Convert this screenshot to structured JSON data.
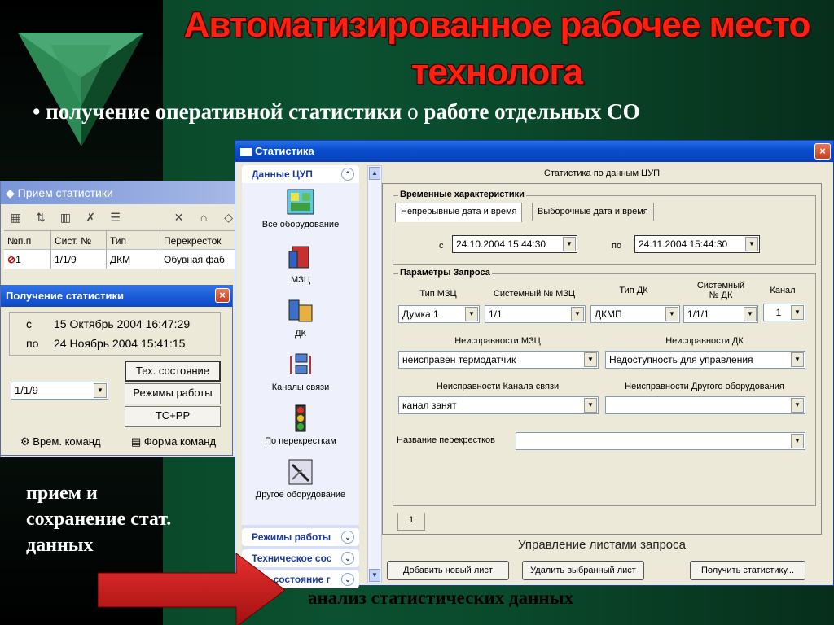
{
  "slide": {
    "title_line1": "Автоматизированное рабочее место",
    "title_line2": "технолога",
    "bullet_prefix": "• получение оперативной статистики",
    "bullet_o": "о",
    "bullet_suffix": "работе отдельных СО",
    "left_text_1": "прием и",
    "left_text_2": "сохранение стат.",
    "left_text_3": "данных",
    "bottom_text": "анализ статистических данных"
  },
  "priem_window": {
    "title": "Прием статистики",
    "columns": [
      "№п.п",
      "Сист. №",
      "Тип",
      "Перекресток"
    ],
    "row": [
      "1",
      "1/1/9",
      "ДКМ",
      "Обувная фаб"
    ]
  },
  "poluch_window": {
    "title": "Получение статистики",
    "close": "×",
    "from_label": "с",
    "from_value": "15 Октябрь 2004 16:47:29",
    "to_label": "по",
    "to_value": "24 Ноябрь 2004 15:41:15",
    "combo_value": "1/1/9",
    "btn_tech": "Тех. состояние",
    "btn_modes": "Режимы работы",
    "btn_tcpp": "ТС+РР",
    "foot_time": "Врем. команд",
    "foot_form": "Форма команд"
  },
  "stat_window": {
    "title": "Статистика",
    "close": "×",
    "sidebar": {
      "header": "Данные ЦУП",
      "items": [
        "Все оборудование",
        "МЗЦ",
        "ДК",
        "Каналы связи",
        "По перекресткам",
        "Другое оборудование"
      ],
      "groups": [
        "Режимы работы",
        "Техническое сос",
        "Тех. состояние г"
      ]
    },
    "main": {
      "caption": "Статистика по данным ЦУП",
      "time_group": "Временные характеристики",
      "tab1": "Непрерывные дата и время",
      "tab2": "Выборочные дата и время",
      "from_label": "с",
      "from_value": "24.10.2004  15:44:30",
      "to_label": "по",
      "to_value": "24.11.2004  15:44:30",
      "params_group": "Параметры Запроса",
      "col_type_mzc": "Тип МЗЦ",
      "col_sys_mzc": "Системный № МЗЦ",
      "col_type_dk": "Тип ДК",
      "col_sys_dk_1": "Системный",
      "col_sys_dk_2": "№ ДК",
      "col_channel": "Канал",
      "val_type_mzc": "Думка 1",
      "val_sys_mzc": "1/1",
      "val_type_dk": "ДКМП",
      "val_sys_dk": "1/1/1",
      "val_channel": "1",
      "lbl_mzc_faults": "Неисправности МЗЦ",
      "lbl_dk_faults": "Неисправности ДК",
      "val_mzc_faults": "неисправен термодатчик",
      "val_dk_faults": "Недоступность для управления",
      "lbl_chan_faults": "Неисправности Канала связи",
      "lbl_other_faults": "Неисправности Другого оборудования",
      "val_chan_faults": "канал занят",
      "val_other_faults": "",
      "lbl_crossroads": "Название перекрестков",
      "val_crossroads": "",
      "sheet_tab": "1",
      "sheets_caption": "Управление листами запроса",
      "btn_add": "Добавить новый лист",
      "btn_delete": "Удалить выбранный лист",
      "btn_get": "Получить статистику..."
    }
  },
  "colors": {
    "title_red": "#ff2010",
    "xp_blue": "#0a4fd0",
    "slide_green": "#0a4a2a"
  }
}
